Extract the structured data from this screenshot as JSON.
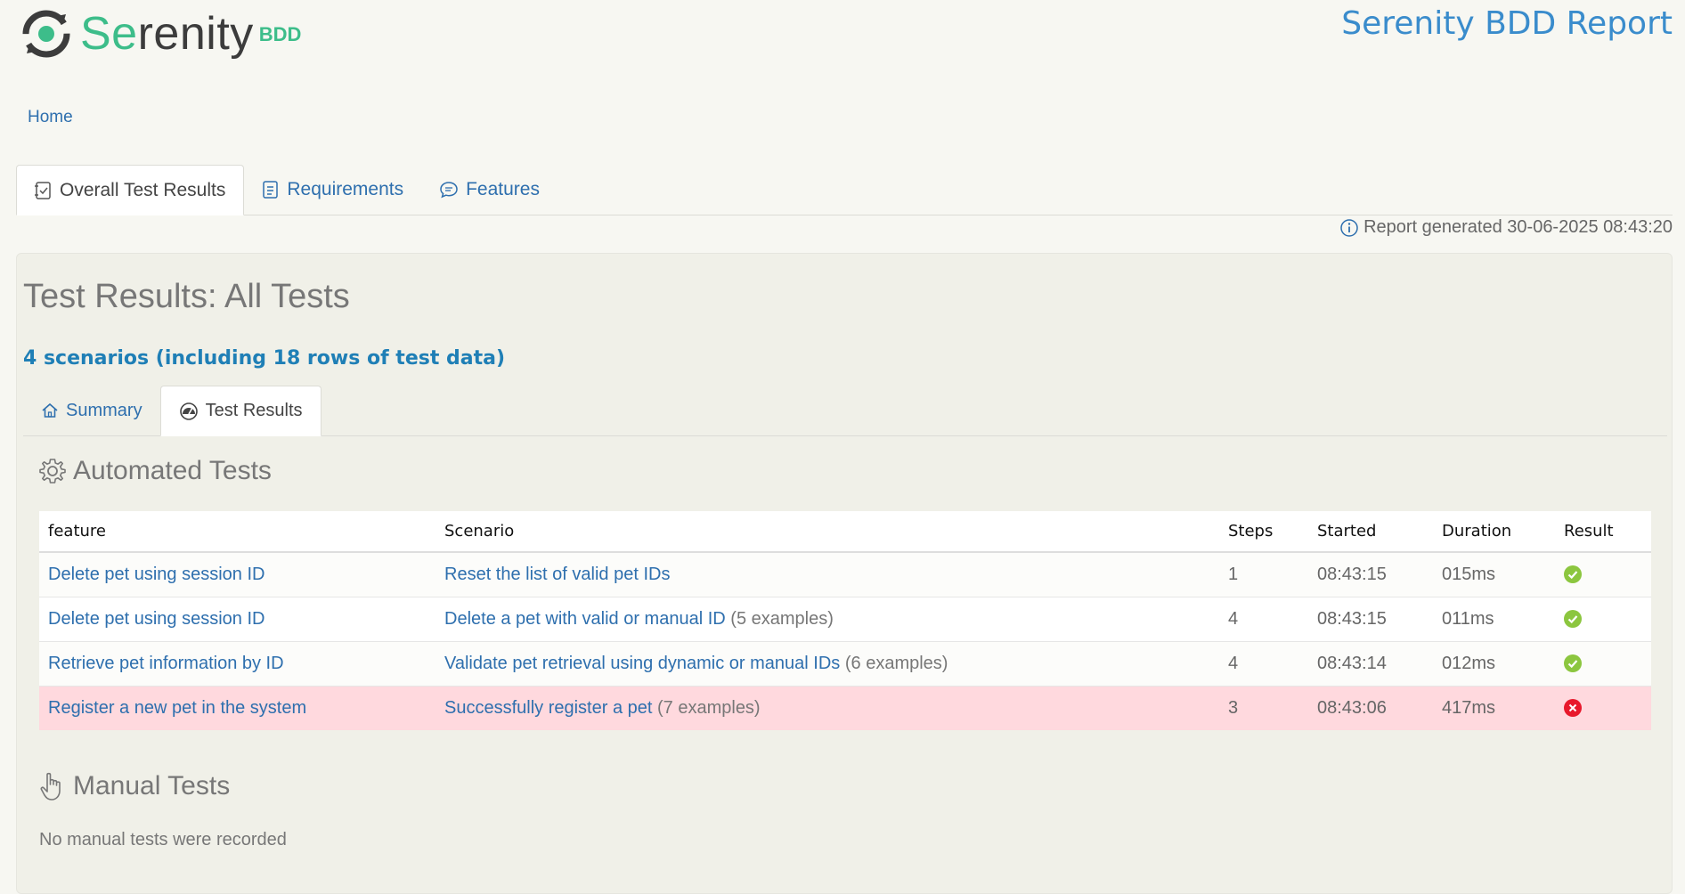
{
  "header": {
    "logo_se": "Se",
    "logo_rest": "renity",
    "logo_bdd": "BDD",
    "report_title": "Serenity BDD Report"
  },
  "breadcrumb": {
    "home": "Home"
  },
  "top_tabs": [
    {
      "label": "Overall Test Results",
      "icon": "checklist-icon",
      "active": true
    },
    {
      "label": "Requirements",
      "icon": "document-icon",
      "active": false
    },
    {
      "label": "Features",
      "icon": "speech-bubble-icon",
      "active": false
    }
  ],
  "report_generated": "Report generated 30-06-2025 08:43:20",
  "main": {
    "heading": "Test Results: All Tests",
    "scenario_count": "4 scenarios (including 18 rows of test data)",
    "sub_tabs": [
      {
        "label": "Summary",
        "icon": "home-icon",
        "active": false
      },
      {
        "label": "Test Results",
        "icon": "gauge-icon",
        "active": true
      }
    ],
    "automated_title": "Automated Tests",
    "manual_title": "Manual Tests",
    "no_manual": "No manual tests were recorded"
  },
  "table": {
    "columns": [
      "feature",
      "Scenario",
      "Steps",
      "Started",
      "Duration",
      "Result"
    ],
    "rows": [
      {
        "feature": "Delete pet using session ID",
        "scenario": "Reset the list of valid pet IDs",
        "examples": "",
        "steps": "1",
        "started": "08:43:15",
        "duration": "015ms",
        "result": "passed"
      },
      {
        "feature": "Delete pet using session ID",
        "scenario": "Delete a pet with valid or manual ID",
        "examples": "(5 examples)",
        "steps": "4",
        "started": "08:43:15",
        "duration": "011ms",
        "result": "passed"
      },
      {
        "feature": "Retrieve pet information by ID",
        "scenario": "Validate pet retrieval using dynamic or manual IDs",
        "examples": "(6 examples)",
        "steps": "4",
        "started": "08:43:14",
        "duration": "012ms",
        "result": "passed"
      },
      {
        "feature": "Register a new pet in the system",
        "scenario": "Successfully register a pet",
        "examples": "(7 examples)",
        "steps": "3",
        "started": "08:43:06",
        "duration": "417ms",
        "result": "failed"
      }
    ]
  },
  "colors": {
    "brand_green": "#3dbd8a",
    "link_blue": "#2e6fae",
    "title_blue": "#3a8ccc",
    "pass_green": "#8cc63f",
    "fail_red": "#e8192c",
    "failed_row_bg": "#ffd9de"
  }
}
